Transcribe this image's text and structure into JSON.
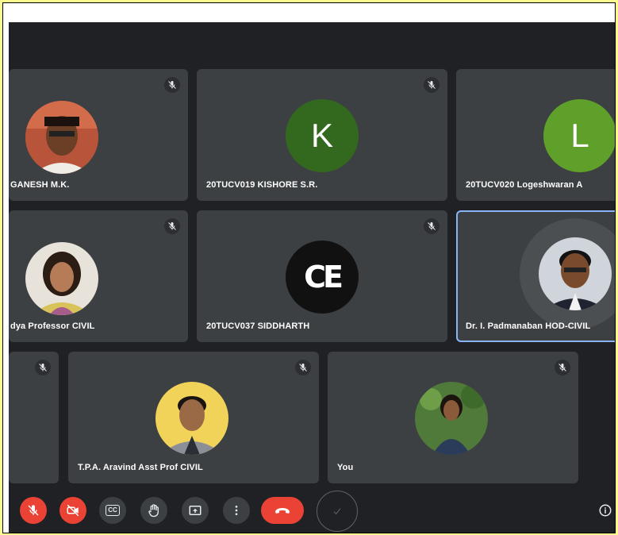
{
  "participants": [
    {
      "name": "GANESH M.K.",
      "muted": true,
      "avatar": "photo"
    },
    {
      "name": "20TUCV019 KISHORE S.R.",
      "muted": true,
      "avatar": "letter",
      "letter": "K",
      "color": "#33691e"
    },
    {
      "name": "20TUCV020 Logeshwaran A",
      "muted": false,
      "avatar": "letter",
      "letter": "L",
      "color": "#5fa02a"
    },
    {
      "name": "dya Professor CIVIL",
      "muted": true,
      "avatar": "photo"
    },
    {
      "name": "20TUCV037 SIDDHARTH",
      "muted": true,
      "avatar": "logo",
      "logo_text": "CE"
    },
    {
      "name": "Dr. I. Padmanaban HOD-CIVIL",
      "muted": false,
      "avatar": "photo",
      "speaking": true
    },
    {
      "name": "",
      "muted": true,
      "avatar": "none"
    },
    {
      "name": "T.P.A. Aravind Asst Prof CIVIL",
      "muted": true,
      "avatar": "photo"
    },
    {
      "name": "You",
      "muted": true,
      "avatar": "photo"
    }
  ],
  "controls": {
    "mic": {
      "icon": "mic-off-icon",
      "state": "off"
    },
    "camera": {
      "icon": "camera-off-icon",
      "state": "off"
    },
    "captions": {
      "icon": "captions-icon",
      "label": "CC"
    },
    "raise_hand": {
      "icon": "hand-icon"
    },
    "present": {
      "icon": "present-screen-icon"
    },
    "more": {
      "icon": "more-vert-icon"
    },
    "hangup": {
      "icon": "hangup-icon"
    },
    "check": {
      "icon": "check-icon"
    },
    "info": {
      "icon": "info-icon"
    }
  },
  "colors": {
    "background": "#202124",
    "tile": "#3c4043",
    "danger": "#ea4335",
    "active_border": "#8ab4f8",
    "frame_highlight": "#fbfb90"
  }
}
